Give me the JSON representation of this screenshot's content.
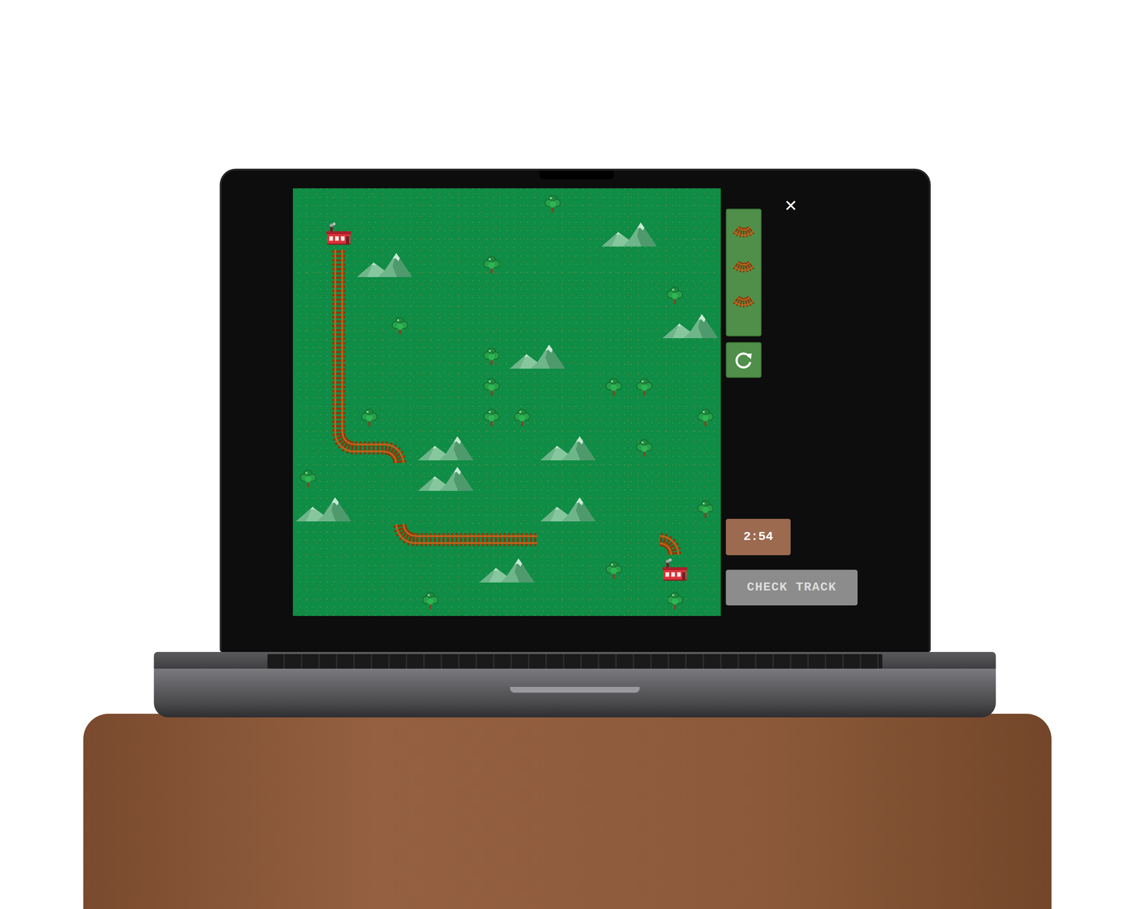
{
  "game": {
    "board": {
      "items": [
        {
          "kind": "tree",
          "row": 0,
          "col": 8
        },
        {
          "kind": "station",
          "row": 1,
          "col": 1
        },
        {
          "kind": "mountain",
          "row": 1,
          "col": 10
        },
        {
          "kind": "mountain",
          "row": 2,
          "col": 2
        },
        {
          "kind": "tree",
          "row": 2,
          "col": 6
        },
        {
          "kind": "tree",
          "row": 3,
          "col": 12
        },
        {
          "kind": "tree",
          "row": 4,
          "col": 3
        },
        {
          "kind": "mountain",
          "row": 4,
          "col": 12
        },
        {
          "kind": "tree",
          "row": 5,
          "col": 6
        },
        {
          "kind": "mountain",
          "row": 5,
          "col": 7
        },
        {
          "kind": "tree",
          "row": 6,
          "col": 6
        },
        {
          "kind": "tree",
          "row": 6,
          "col": 10
        },
        {
          "kind": "tree",
          "row": 6,
          "col": 11
        },
        {
          "kind": "tree",
          "row": 7,
          "col": 2
        },
        {
          "kind": "tree",
          "row": 7,
          "col": 6
        },
        {
          "kind": "tree",
          "row": 7,
          "col": 7
        },
        {
          "kind": "tree",
          "row": 7,
          "col": 13
        },
        {
          "kind": "mountain",
          "row": 8,
          "col": 4
        },
        {
          "kind": "mountain",
          "row": 8,
          "col": 8
        },
        {
          "kind": "tree",
          "row": 8,
          "col": 11
        },
        {
          "kind": "tree",
          "row": 9,
          "col": 0
        },
        {
          "kind": "mountain",
          "row": 9,
          "col": 4
        },
        {
          "kind": "mountain",
          "row": 10,
          "col": 0
        },
        {
          "kind": "mountain",
          "row": 10,
          "col": 8
        },
        {
          "kind": "tree",
          "row": 10,
          "col": 13
        },
        {
          "kind": "mountain",
          "row": 12,
          "col": 6
        },
        {
          "kind": "tree",
          "row": 12,
          "col": 10
        },
        {
          "kind": "station",
          "row": 12,
          "col": 12
        },
        {
          "kind": "tree",
          "row": 13,
          "col": 4
        },
        {
          "kind": "tree",
          "row": 13,
          "col": 12
        },
        {
          "kind": "track-vertical",
          "row": 2,
          "col": 1
        },
        {
          "kind": "track-vertical",
          "row": 3,
          "col": 1
        },
        {
          "kind": "track-vertical",
          "row": 4,
          "col": 1
        },
        {
          "kind": "track-vertical",
          "row": 5,
          "col": 1
        },
        {
          "kind": "track-vertical",
          "row": 6,
          "col": 1
        },
        {
          "kind": "track-vertical",
          "row": 7,
          "col": 1
        },
        {
          "kind": "track-curve-ne",
          "row": 8,
          "col": 1
        },
        {
          "kind": "track-horizontal",
          "row": 8,
          "col": 2
        },
        {
          "kind": "track-curve-sw",
          "row": 8,
          "col": 3
        },
        {
          "kind": "track-curve-ne",
          "row": 11,
          "col": 3
        },
        {
          "kind": "track-horizontal",
          "row": 11,
          "col": 4
        },
        {
          "kind": "track-horizontal",
          "row": 11,
          "col": 5
        },
        {
          "kind": "track-horizontal",
          "row": 11,
          "col": 6
        },
        {
          "kind": "track-horizontal",
          "row": 11,
          "col": 7
        },
        {
          "kind": "track-curve-sw",
          "row": 11,
          "col": 12
        }
      ]
    },
    "palette": [
      {
        "kind": "curve"
      },
      {
        "kind": "curve"
      },
      {
        "kind": "curve"
      }
    ],
    "close": {
      "label": "✕"
    },
    "timer": {
      "text": "2:54"
    },
    "check_button": {
      "label": "CHECK TRACK",
      "disabled": true
    }
  }
}
